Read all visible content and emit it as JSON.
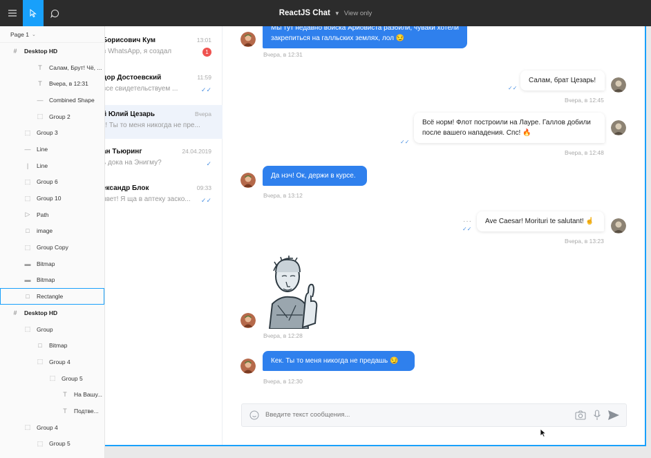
{
  "app": {
    "title": "ReactJS Chat",
    "mode": "View only",
    "page": "Page 1"
  },
  "layers": [
    {
      "label": "Desktop HD",
      "icon": "frame-icon",
      "depth": 0,
      "frame": true
    },
    {
      "label": "Салам, Брут! Чё, ...",
      "icon": "text-icon",
      "depth": 2
    },
    {
      "label": "Вчера, в 12:31",
      "icon": "text-icon",
      "depth": 2
    },
    {
      "label": "Combined Shape",
      "icon": "shape-icon",
      "depth": 2
    },
    {
      "label": "Group 2",
      "icon": "group-icon",
      "depth": 2
    },
    {
      "label": "Group 3",
      "icon": "group-icon",
      "depth": 1
    },
    {
      "label": "Line",
      "icon": "line-icon",
      "depth": 1
    },
    {
      "label": "Line",
      "icon": "vline-icon",
      "depth": 1
    },
    {
      "label": "Group 6",
      "icon": "group-icon",
      "depth": 1
    },
    {
      "label": "Group 10",
      "icon": "group-icon",
      "depth": 1
    },
    {
      "label": "Path",
      "icon": "path-icon",
      "depth": 1
    },
    {
      "label": "image",
      "icon": "rect-icon",
      "depth": 1
    },
    {
      "label": "Group Copy",
      "icon": "group-icon",
      "depth": 1
    },
    {
      "label": "Bitmap",
      "icon": "bitmap-icon",
      "depth": 1
    },
    {
      "label": "Bitmap",
      "icon": "bitmap-icon",
      "depth": 1
    },
    {
      "label": "Rectangle",
      "icon": "rect-icon",
      "depth": 1,
      "selected": true
    },
    {
      "label": "Desktop HD",
      "icon": "frame-icon",
      "depth": 0,
      "frame": true
    },
    {
      "label": "Group",
      "icon": "group-icon",
      "depth": 1
    },
    {
      "label": "Bitmap",
      "icon": "rect-icon",
      "depth": 2
    },
    {
      "label": "Group 4",
      "icon": "group-icon",
      "depth": 2
    },
    {
      "label": "Group 5",
      "icon": "group-icon",
      "depth": 3
    },
    {
      "label": "На Вашу...",
      "icon": "text-icon",
      "depth": 4
    },
    {
      "label": "Подтве...",
      "icon": "text-icon",
      "depth": 4
    },
    {
      "label": "Group 4",
      "icon": "group-icon",
      "depth": 1
    },
    {
      "label": "Group 5",
      "icon": "group-icon",
      "depth": 2
    }
  ],
  "conversations": [
    {
      "name": "Борисович Кум",
      "time": "13:01",
      "preview": "в WhatsApp, я создал",
      "badge": "1"
    },
    {
      "name": "дор Достоевский",
      "time": "11:59",
      "preview": "все свидетельствуем ...",
      "read": "double"
    },
    {
      "name": "й Юлий Цезарь",
      "time": "Вчера",
      "preview": "к! Ты то меня никогда не пре...",
      "active": true
    },
    {
      "name": "ан Тьюринг",
      "time": "24.04.2019",
      "preview": "ь дока на Энигму?",
      "read": "single"
    },
    {
      "name": "ександр Блок",
      "time": "09:33",
      "preview": "ивет! Я ща в аптеку заско...",
      "read": "double"
    }
  ],
  "messages": [
    {
      "dir": "in",
      "text": "Мы тут недавно войска Ариовиста разбили, чуваки хотели закрепиться на галльских землях, лол 😏",
      "time": "Вчера, в 12:31"
    },
    {
      "dir": "out",
      "text": "Салам, брат Цезарь!",
      "time": "Вчера, в 12:45"
    },
    {
      "dir": "out",
      "text": "Всё норм! Флот построили на Лауре. Галлов добили после вашего нападения. Спс! 🔥",
      "time": "Вчера, в 12:48"
    },
    {
      "dir": "in",
      "text": "Да нэч! Ок, держи в курсе.",
      "time": "Вчера, в 13:12"
    },
    {
      "dir": "out",
      "text": "Ave Caesar! Morituri te salutant! ☝",
      "time": "Вчера, в 13:23"
    },
    {
      "dir": "in",
      "sticker": "caesar-thumbs-up-sticker",
      "time": "Вчера, в 12:28"
    },
    {
      "dir": "in",
      "text": "Кек. Ты то меня никогда не предашь 😏",
      "time": "Вчера, в 12:30"
    }
  ],
  "composer": {
    "placeholder": "Введите текст сообщения..."
  },
  "colors": {
    "accent": "#18a0fb",
    "bubble_in": "#2f80ed",
    "toolbar": "#2c2c2c"
  }
}
